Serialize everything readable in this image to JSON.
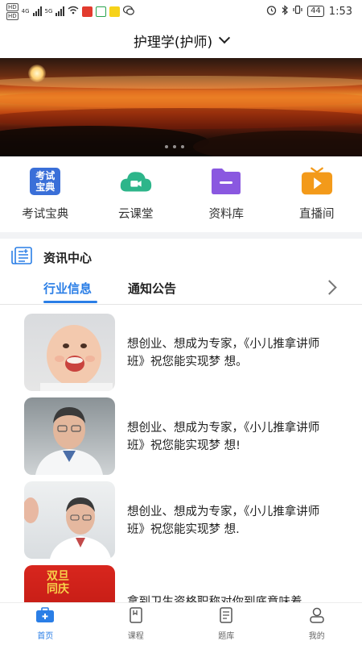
{
  "status_bar": {
    "network_left": [
      "4G",
      "5G"
    ],
    "app_badges": [
      "news-badge",
      "message-badge",
      "vv-badge",
      "chat-badge"
    ],
    "battery": "44",
    "time": "1:53"
  },
  "header": {
    "title": "护理学(护师)"
  },
  "banner": {
    "dots_count": 3
  },
  "quick_nav": [
    {
      "label": "考试宝典",
      "icon": "exam-book-icon",
      "icon_text_top": "考试",
      "icon_text_bottom": "宝典",
      "color": "#3a6fd8"
    },
    {
      "label": "云课堂",
      "icon": "cloud-video-icon",
      "color": "#2db58a"
    },
    {
      "label": "资料库",
      "icon": "folder-icon",
      "color": "#8a58e0"
    },
    {
      "label": "直播间",
      "icon": "tv-play-icon",
      "color": "#f39a1a"
    }
  ],
  "news_center": {
    "title": "资讯中心",
    "tabs": [
      {
        "label": "行业信息",
        "active": true
      },
      {
        "label": "通知公告",
        "active": false
      }
    ],
    "items": [
      {
        "text": "想创业、想成为专家，《小儿推拿讲师班》祝您能实现梦 想。",
        "thumb": "baby-photo"
      },
      {
        "text": "想创业、想成为专家，《小儿推拿讲师班》祝您能实现梦 想!",
        "thumb": "doctor-photo"
      },
      {
        "text": "想创业、想成为专家，《小儿推拿讲师班》祝您能实现梦 想.",
        "thumb": "doctor-consult-photo"
      },
      {
        "text": "拿到卫生资格职称对你到底意味着",
        "thumb": "promo-photo",
        "thumb_text": "双旦同庆"
      }
    ]
  },
  "tab_bar": [
    {
      "label": "首页",
      "icon": "home-medkit-icon",
      "active": true
    },
    {
      "label": "课程",
      "icon": "course-book-icon",
      "active": false
    },
    {
      "label": "题库",
      "icon": "question-bank-icon",
      "active": false
    },
    {
      "label": "我的",
      "icon": "user-icon",
      "active": false
    }
  ],
  "colors": {
    "accent": "#2a7ee6",
    "divider": "#f2f3f5"
  }
}
